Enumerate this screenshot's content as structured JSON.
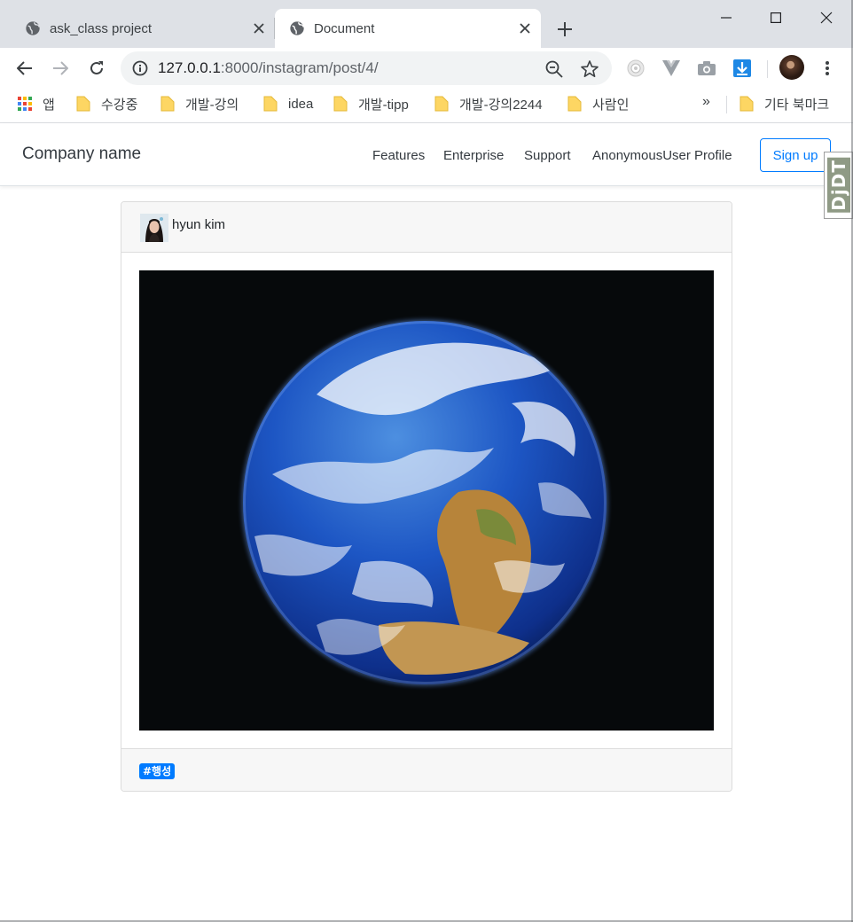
{
  "browser": {
    "tabs": [
      {
        "title": "ask_class project",
        "active": false
      },
      {
        "title": "Document",
        "active": true
      }
    ],
    "address": {
      "host": "127.0.0.1",
      "path": ":8000/instagram/post/4/"
    },
    "bookmarks": [
      {
        "label": "앱",
        "icon": "apps-grid-icon"
      },
      {
        "label": "수강중",
        "icon": "folder-icon"
      },
      {
        "label": "개발-강의",
        "icon": "folder-icon"
      },
      {
        "label": "idea",
        "icon": "folder-icon"
      },
      {
        "label": "개발-tipp",
        "icon": "folder-icon"
      },
      {
        "label": "개발-강의2244",
        "icon": "folder-icon"
      },
      {
        "label": "사람인",
        "icon": "folder-icon"
      }
    ],
    "bookmarks_more": "»",
    "other_bookmarks": "기타 북마크"
  },
  "navbar": {
    "brand": "Company name",
    "links": [
      "Features",
      "Enterprise",
      "Support",
      "AnonymousUser Profile"
    ],
    "signup": "Sign up",
    "ddt_badge": "DjDT"
  },
  "post": {
    "author": "hyun kim",
    "image_alt": "earth-photo",
    "tags": [
      "#행성"
    ]
  },
  "colors": {
    "primary": "#007bff",
    "tab_strip": "#dee1e6",
    "card_header": "#f7f7f7"
  }
}
